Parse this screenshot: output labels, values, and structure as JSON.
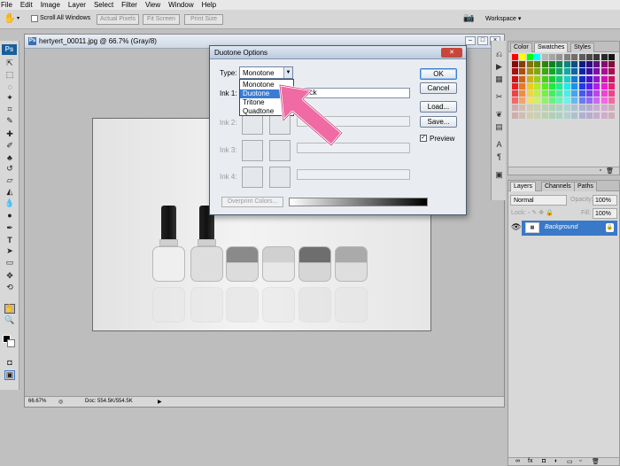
{
  "menu": [
    "File",
    "Edit",
    "Image",
    "Layer",
    "Select",
    "Filter",
    "View",
    "Window",
    "Help"
  ],
  "options": {
    "scroll_all_windows": "Scroll All Windows",
    "actual_pixels": "Actual Pixels",
    "fit_screen": "Fit Screen",
    "print_size": "Print Size",
    "workspace": "Workspace ▾"
  },
  "toolbar": {
    "logo": "Ps"
  },
  "document": {
    "title": "hertyert_00011.jpg @ 66.7% (Gray/8)",
    "zoom": "66.67%",
    "doc_info": "Doc: 554.5K/554.5K"
  },
  "dialog": {
    "title": "Duotone Options",
    "type_label": "Type:",
    "type_value": "Monotone",
    "options": [
      "Monotone",
      "Duotone",
      "Tritone",
      "Quadtone"
    ],
    "ink1_label": "Ink 1:",
    "ink1_name": "Black",
    "ink2_label": "Ink 2:",
    "ink3_label": "Ink 3:",
    "ink4_label": "Ink 4:",
    "ok": "OK",
    "cancel": "Cancel",
    "load": "Load...",
    "save": "Save...",
    "preview": "Preview",
    "overprint": "Overprint Colors..."
  },
  "swatches_panel": {
    "tabs": [
      "Color",
      "Swatches",
      "Styles"
    ],
    "active_tab": "Swatches"
  },
  "layers_panel": {
    "tabs": [
      "Layers",
      "Channels",
      "Paths"
    ],
    "active_tab": "Layers",
    "blend_mode": "Normal",
    "opacity_label": "Opacity:",
    "opacity": "100%",
    "lock_label": "Lock:",
    "fill_label": "Fill:",
    "fill": "100%",
    "layer_name": "Background"
  },
  "colors": {
    "accent": "#3a78c8",
    "arrow": "#f06aa3"
  }
}
